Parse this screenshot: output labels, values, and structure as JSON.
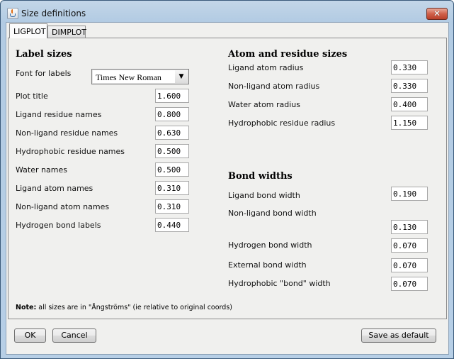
{
  "window": {
    "title": "Size definitions",
    "close_label": "✕"
  },
  "tabs": [
    {
      "label": "LIGPLOT",
      "active": true
    },
    {
      "label": "DIMPLOT",
      "active": false
    }
  ],
  "label_sizes": {
    "heading": "Label sizes",
    "font_label": "Font for labels",
    "font_value": "Times New Roman",
    "rows": [
      {
        "label": "Plot title",
        "value": "1.600"
      },
      {
        "label": "Ligand residue names",
        "value": "0.800"
      },
      {
        "label": "Non-ligand residue names",
        "value": "0.630"
      },
      {
        "label": "Hydrophobic residue names",
        "value": "0.500"
      },
      {
        "label": "Water names",
        "value": "0.500"
      },
      {
        "label": "Ligand atom names",
        "value": "0.310"
      },
      {
        "label": "Non-ligand atom names",
        "value": "0.310"
      },
      {
        "label": "Hydrogen bond labels",
        "value": "0.440"
      }
    ]
  },
  "atom_residue_sizes": {
    "heading": "Atom and residue sizes",
    "rows": [
      {
        "label": "Ligand atom radius",
        "value": "0.330"
      },
      {
        "label": "Non-ligand atom radius",
        "value": "0.330"
      },
      {
        "label": "Water atom radius",
        "value": "0.400"
      },
      {
        "label": "Hydrophobic residue radius",
        "value": "1.150"
      }
    ]
  },
  "bond_widths": {
    "heading": "Bond widths",
    "rows": [
      {
        "label": "Ligand bond width",
        "value": "0.190"
      },
      {
        "label": "Non-ligand bond width",
        "value": "0.130"
      },
      {
        "label": "Hydrogen bond width",
        "value": "0.070"
      },
      {
        "label": "External bond width",
        "value": "0.070"
      },
      {
        "label": "Hydrophobic \"bond\" width",
        "value": "0.070"
      }
    ]
  },
  "note": {
    "bold": "Note:",
    "text": " all sizes are in \"Ångströms\" (ie relative to original coords)"
  },
  "buttons": {
    "ok": "OK",
    "cancel": "Cancel",
    "save_default": "Save as default"
  }
}
